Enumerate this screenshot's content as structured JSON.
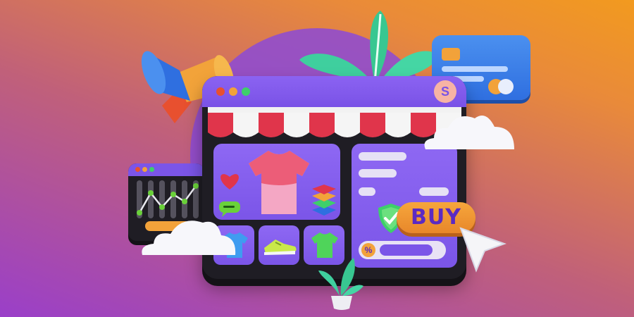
{
  "buy_button": {
    "label": "BUY"
  },
  "store_badge": {
    "icon": "shopify-bag-icon",
    "glyph": "S"
  },
  "discount_bar": {
    "icon": "percent-icon",
    "glyph": "%",
    "fill_fraction": 0.85
  },
  "colors": {
    "background_start": "#9a3fc9",
    "background_end": "#f29a1f",
    "window_purple": "#7b55e8",
    "awning_red": "#e0354b",
    "buy_orange": "#e8872a",
    "card_blue": "#2f6fe0"
  },
  "products": [
    {
      "name": "blue-tshirt",
      "icon": "tshirt-icon"
    },
    {
      "name": "sneaker",
      "icon": "shoe-icon"
    },
    {
      "name": "green-tshirt",
      "icon": "tshirt-icon"
    }
  ]
}
